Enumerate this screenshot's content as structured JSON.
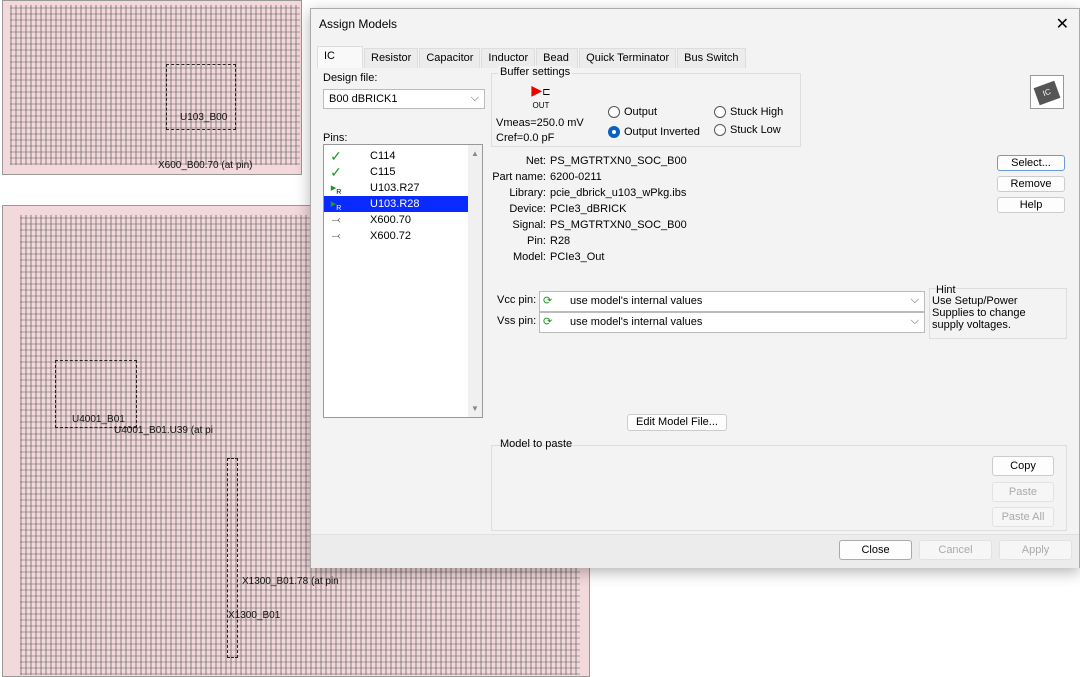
{
  "background": {
    "labels": [
      "U103_B00",
      "X600_B00.70 (at pin)",
      "U4001_B01",
      "U4001_B01.U39 (at pi",
      "X1300_B01.78 (at pin",
      "X1300_B01"
    ]
  },
  "dialog": {
    "title": "Assign Models",
    "tabs": [
      "IC",
      "Resistor",
      "Capacitor",
      "Inductor",
      "Bead",
      "Quick Terminator",
      "Bus Switch"
    ],
    "design_file": {
      "label": "Design file:",
      "value": "B00 dBRICK1"
    },
    "pins": {
      "label": "Pins:",
      "items": [
        {
          "icon": "check-icon",
          "name": "C114",
          "selected": false
        },
        {
          "icon": "check-icon",
          "name": "C115",
          "selected": false
        },
        {
          "icon": "driver-receiver-icon",
          "name": "U103.R27",
          "selected": false
        },
        {
          "icon": "driver-receiver-icon",
          "name": "U103.R28",
          "selected": true
        },
        {
          "icon": "connector-pin-icon",
          "name": "X600.70",
          "selected": false
        },
        {
          "icon": "connector-pin-icon",
          "name": "X600.72",
          "selected": false
        }
      ]
    },
    "buffer": {
      "label": "Buffer settings",
      "icon_text": "OUT",
      "vmeas": "Vmeas=250.0 mV",
      "cref": "Cref=0.0 pF",
      "options": [
        {
          "label": "Output",
          "checked": false
        },
        {
          "label": "Output Inverted",
          "checked": true
        },
        {
          "label": "Stuck High",
          "checked": false
        },
        {
          "label": "Stuck Low",
          "checked": false
        }
      ]
    },
    "info": [
      {
        "k": "Net:",
        "v": "PS_MGTRTXN0_SOC_B00"
      },
      {
        "k": "Part name:",
        "v": "6200-0211"
      },
      {
        "k": "Library:",
        "v": "pcie_dbrick_u103_wPkg.ibs"
      },
      {
        "k": "Device:",
        "v": "PCIe3_dBRICK"
      },
      {
        "k": "Signal:",
        "v": "PS_MGTRTXN0_SOC_B00"
      },
      {
        "k": "Pin:",
        "v": "R28"
      },
      {
        "k": "Model:",
        "v": "PCIe3_Out"
      }
    ],
    "side_buttons": [
      "Select...",
      "Remove",
      "Help"
    ],
    "vcc": {
      "label": "Vcc pin:",
      "value": "use model's internal values"
    },
    "vss": {
      "label": "Vss pin:",
      "value": "use model's internal values"
    },
    "hint": {
      "label": "Hint",
      "text": "Use Setup/Power Supplies to change supply voltages."
    },
    "edit_model": "Edit Model File...",
    "paste_group": {
      "label": "Model to paste",
      "copy": "Copy",
      "paste": "Paste",
      "paste_all": "Paste All"
    },
    "footer": {
      "close": "Close",
      "cancel": "Cancel",
      "apply": "Apply"
    },
    "accent": "#0a2bff"
  }
}
